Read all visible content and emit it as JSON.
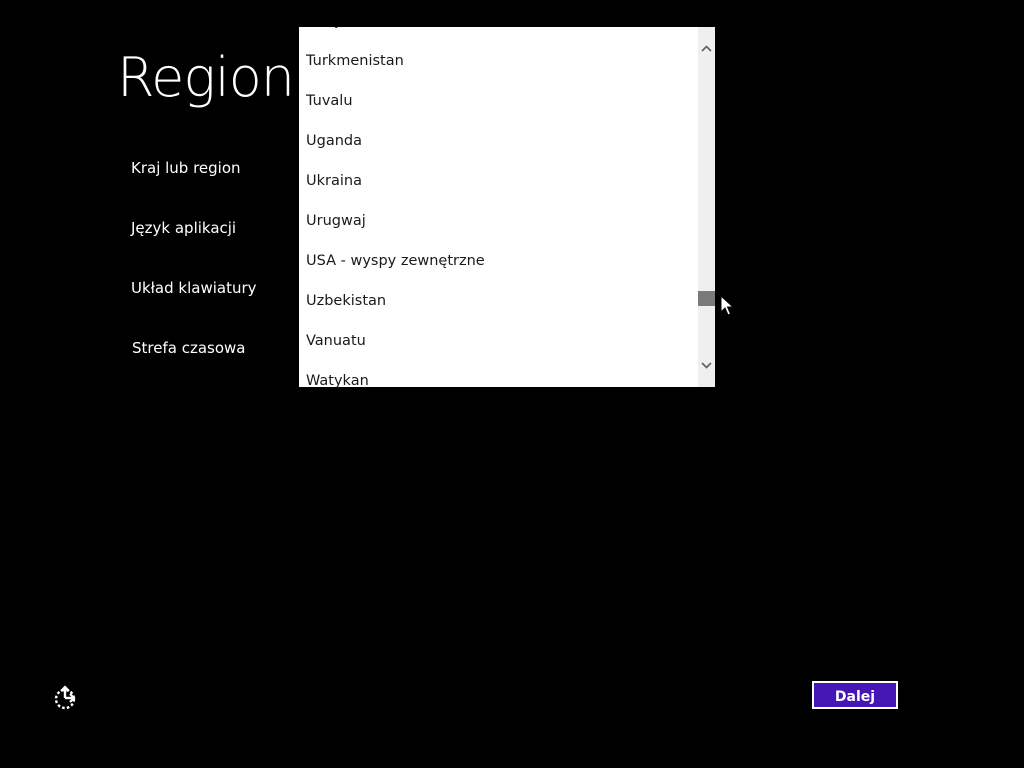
{
  "page": {
    "title": "Region"
  },
  "settings": {
    "country_label": "Kraj lub region",
    "app_language_label": "Język aplikacji",
    "keyboard_label": "Układ klawiatury",
    "timezone_label": "Strefa czasowa"
  },
  "country_dropdown": {
    "items": [
      "Turcja",
      "Turkmenistan",
      "Tuvalu",
      "Uganda",
      "Ukraina",
      "Urugwaj",
      "USA - wyspy zewnętrzne",
      "Uzbekistan",
      "Vanuatu",
      "Watykan"
    ]
  },
  "footer": {
    "next_label": "Dalej",
    "accessibility_icon": "ease-of-access-icon"
  },
  "colors": {
    "background": "#000000",
    "accent": "#4617b4",
    "list_bg": "#ffffff",
    "scrollbar_thumb": "#7a7a7a"
  }
}
